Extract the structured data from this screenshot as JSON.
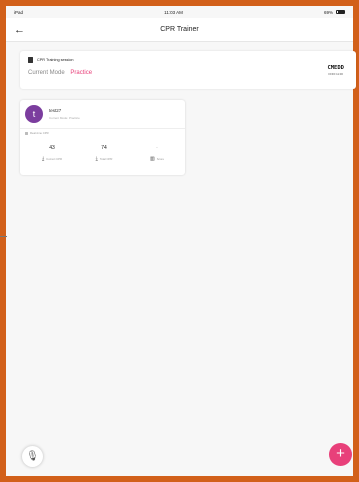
{
  "status_bar": {
    "carrier": "iPad",
    "time": "11:03 AM",
    "battery": "69%"
  },
  "nav": {
    "back_icon": "arrow-left-icon",
    "title": "CPR Trainer"
  },
  "session": {
    "title": "CPR Training session",
    "mode_label": "Current Mode",
    "mode_value": "Practice",
    "device_name": "CMEDD",
    "device_sub": "FFFF:11:00"
  },
  "user": {
    "initial": "t",
    "name": "test27",
    "subtitle": "Current Mode: Practice",
    "section_label": "Real-time CPR",
    "metrics": [
      {
        "value": "43",
        "label": "Correct CPR",
        "icon": "download-icon"
      },
      {
        "value": "74",
        "label": "Total CPR",
        "icon": "download-icon"
      },
      {
        "value": "-",
        "label": "Score",
        "icon": "chart-icon"
      }
    ]
  },
  "colors": {
    "border": "#d2601a",
    "accent": "#e8407a",
    "avatar": "#7b3d9e"
  }
}
